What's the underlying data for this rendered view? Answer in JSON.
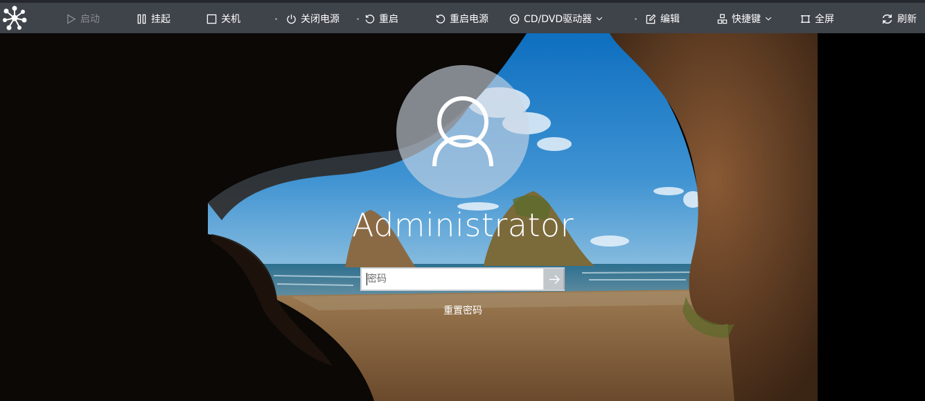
{
  "toolbar": {
    "logo_icon": "network-logo-icon",
    "items": [
      {
        "label": "启动",
        "icon": "play-icon",
        "enabled": false
      },
      {
        "label": "挂起",
        "icon": "pause-icon",
        "enabled": true
      },
      {
        "label": "关机",
        "icon": "square-icon",
        "enabled": true
      },
      {
        "label": "关闭电源",
        "icon": "power-icon",
        "enabled": true
      },
      {
        "label": "重启",
        "icon": "restart-icon",
        "enabled": true
      },
      {
        "label": "重启电源",
        "icon": "power-restart-icon",
        "enabled": true
      },
      {
        "label": "CD/DVD驱动器",
        "icon": "disc-icon",
        "enabled": true
      },
      {
        "label": "编辑",
        "icon": "edit-icon",
        "enabled": true
      },
      {
        "label": "快捷键",
        "icon": "shortcut-grid-icon",
        "enabled": true
      },
      {
        "label": "全屏",
        "icon": "fullscreen-icon",
        "enabled": true
      },
      {
        "label": "刷新",
        "icon": "refresh-icon",
        "enabled": true
      }
    ]
  },
  "login": {
    "username": "Administrator",
    "password_placeholder": "密码",
    "password_value": "",
    "submit_icon": "arrow-right-icon",
    "reset_label": "重置密码"
  },
  "colors": {
    "toolbar_bg": "#3f434a",
    "toolbar_text": "#ffffff",
    "toolbar_disabled": "#8a8d92"
  }
}
